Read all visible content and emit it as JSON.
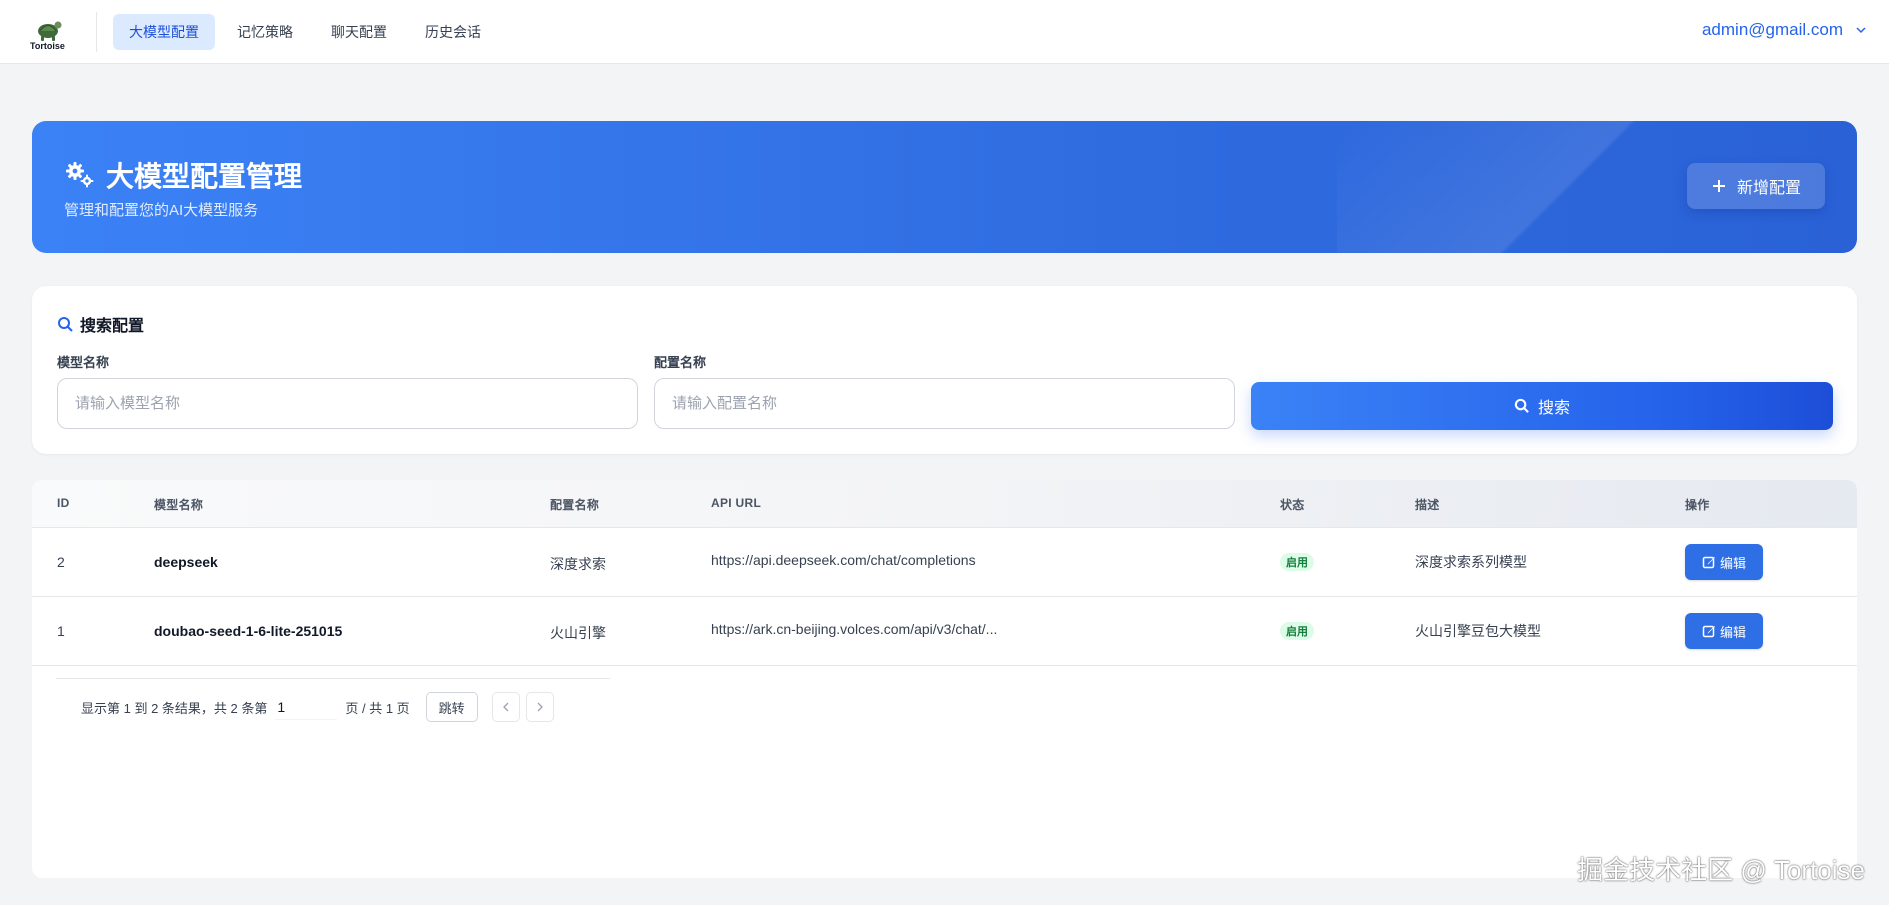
{
  "app": {
    "logo_text": "Tortoise",
    "logo_icon": "tortoise-icon"
  },
  "nav": {
    "items": [
      {
        "label": "大模型配置",
        "active": true
      },
      {
        "label": "记忆策略",
        "active": false
      },
      {
        "label": "聊天配置",
        "active": false
      },
      {
        "label": "历史会话",
        "active": false
      }
    ]
  },
  "user": {
    "email": "admin@gmail.com",
    "menu_icon": "chevron-down-icon"
  },
  "hero": {
    "icon": "gears-icon",
    "title": "大模型配置管理",
    "subtitle": "管理和配置您的AI大模型服务",
    "add_button": "新增配置"
  },
  "search": {
    "heading": "搜索配置",
    "model_name_label": "模型名称",
    "model_name_placeholder": "请输入模型名称",
    "model_name_value": "",
    "config_name_label": "配置名称",
    "config_name_placeholder": "请输入配置名称",
    "config_name_value": "",
    "button": "搜索"
  },
  "table": {
    "columns": [
      "ID",
      "模型名称",
      "配置名称",
      "API URL",
      "状态",
      "描述",
      "操作"
    ],
    "rows": [
      {
        "id": "2",
        "model_name": "deepseek",
        "config_name": "深度求索",
        "api_url": "https://api.deepseek.com/chat/completions",
        "status": "启用",
        "description": "深度求索系列模型",
        "action": "编辑"
      },
      {
        "id": "1",
        "model_name": "doubao-seed-1-6-lite-251015",
        "config_name": "火山引擎",
        "api_url": "https://ark.cn-beijing.volces.com/api/v3/chat/...",
        "status": "启用",
        "description": "火山引擎豆包大模型",
        "action": "编辑"
      }
    ],
    "colors": {
      "status_bg": "#dcfce7",
      "status_text": "#15803d",
      "edit_button": "#2f6fe6"
    }
  },
  "pagination": {
    "summary": "显示第 1 到 2 条结果，共 2 条第",
    "current_page": "1",
    "page_suffix": "页 / 共 1 页",
    "jump_button": "跳转"
  },
  "watermark": "掘金技术社区 @ Tortoise",
  "colors": {
    "accent": "#2563eb",
    "hero_start": "#3b82f6",
    "hero_end": "#2a61d6",
    "page_bg": "#f3f4f6"
  }
}
